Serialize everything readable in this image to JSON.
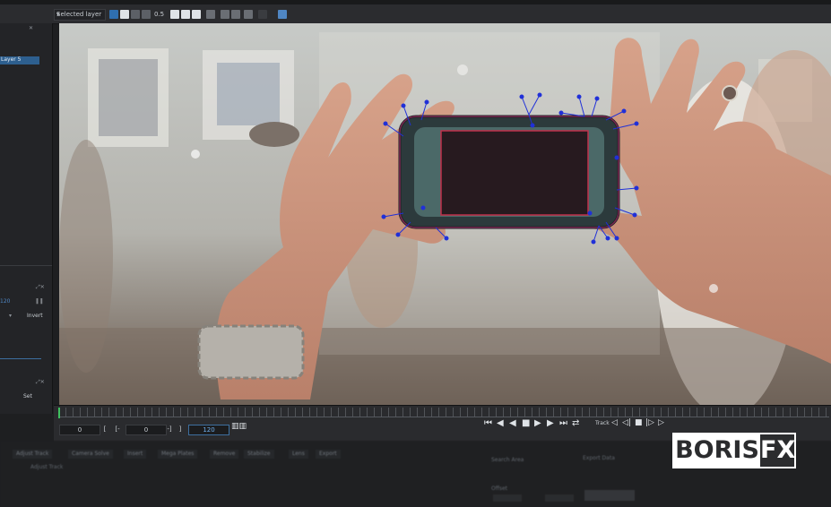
{
  "toolbar": {
    "layer_select": "Selected layer",
    "zoom_value": "0.5"
  },
  "sidebar": {
    "layer_item": "Layer 5",
    "frame_value": "120",
    "invert_label": "Invert",
    "set_label": "Set"
  },
  "timeline": {
    "field_start": "0",
    "field_in": "0",
    "field_out": "120",
    "track_label": "Track",
    "in_bracket": "[",
    "in_bracket2": "[-",
    "out_bracket": "-]",
    "out_bracket2": "]"
  },
  "bottom_tabs": [
    "Adjust Track",
    "Camera Solve",
    "Insert",
    "Mega Plates",
    "Remove",
    "Stabilize",
    "Lens",
    "Export"
  ],
  "bottom_labels": {
    "adjust": "Adjust Track",
    "export_label": "Export Data",
    "search_area": "Search Area",
    "offset": "Offset"
  },
  "logo": {
    "boris": "BORIS",
    "fx": "FX"
  },
  "colors": {
    "accent": "#2d5f8f",
    "track_points": "#2030d8",
    "planar_outline": "#c0304a"
  }
}
